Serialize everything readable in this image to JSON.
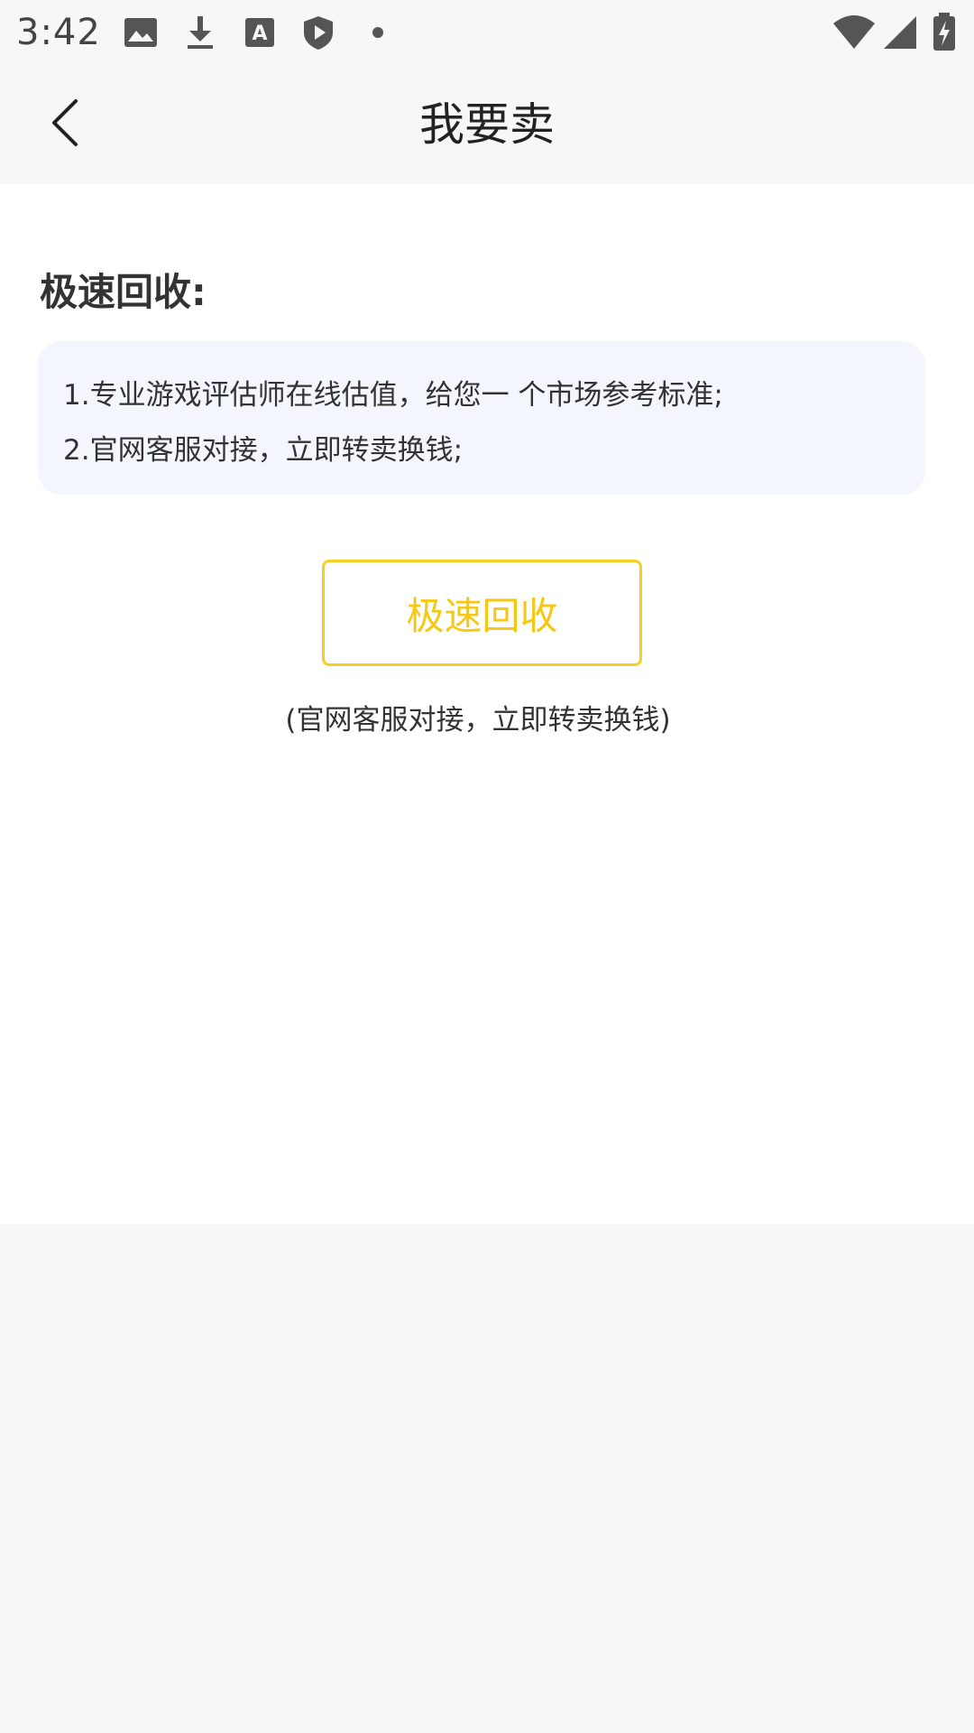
{
  "status_bar": {
    "time": "3:42",
    "left_icons": [
      "image-icon",
      "download-icon",
      "font-a-icon",
      "shield-play-icon",
      "dot-icon"
    ],
    "right_icons": [
      "wifi-icon",
      "signal-icon",
      "battery-icon"
    ]
  },
  "header": {
    "back_icon": "chevron-left-icon",
    "title": "我要卖"
  },
  "section": {
    "title": "极速回收:",
    "lines": [
      "1.专业游戏评估师在线估值，给您一 个市场参考标准;",
      "2.官网客服对接，立即转卖换钱;"
    ]
  },
  "action": {
    "button_label": "极速回收",
    "caption": "(官网客服对接，立即转卖换钱)"
  },
  "colors": {
    "accent": "#f6c814",
    "card_bg": "#f3f6fc",
    "page_bg": "#f7f7f7"
  }
}
